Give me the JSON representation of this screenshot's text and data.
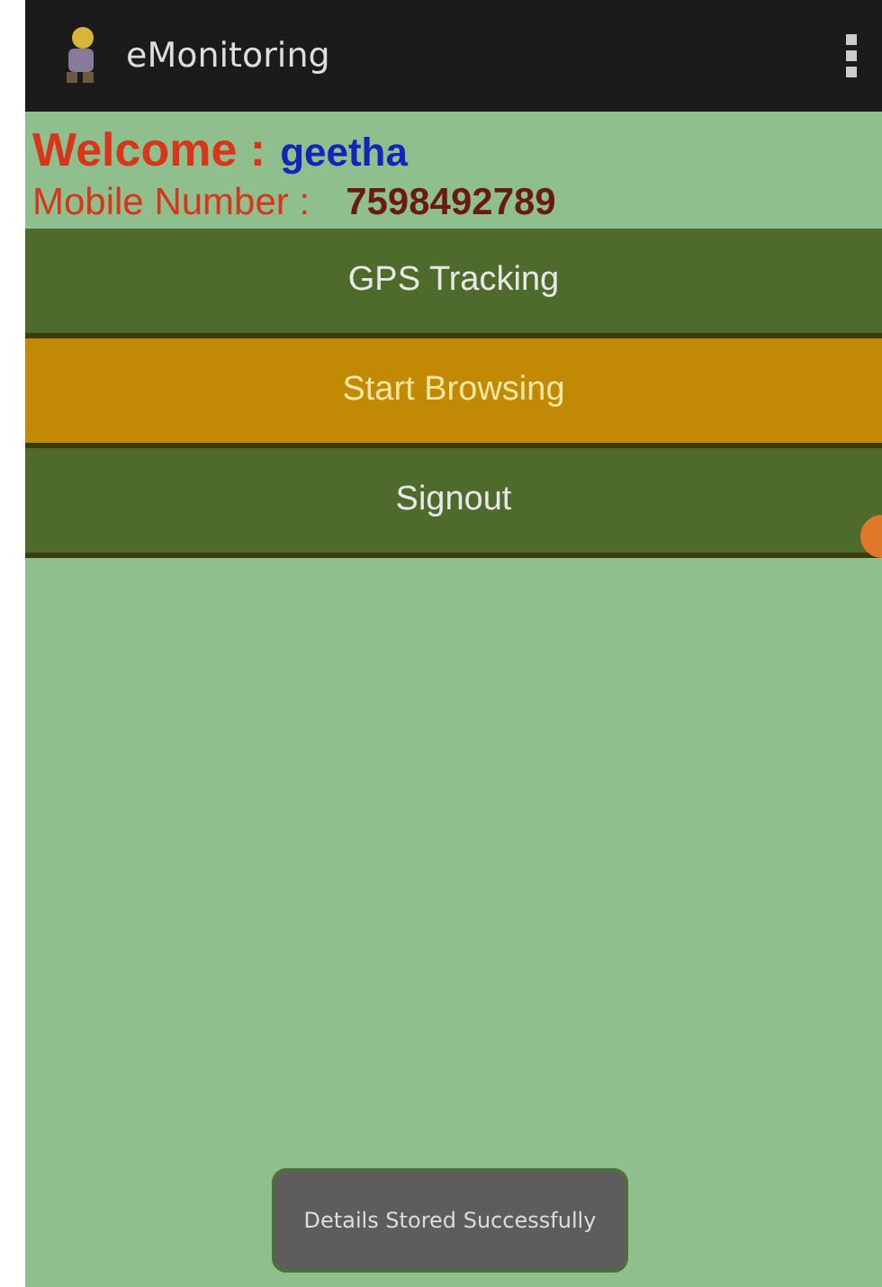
{
  "app_bar": {
    "title": "eMonitoring"
  },
  "welcome": {
    "label": "Welcome :",
    "name": "geetha"
  },
  "mobile": {
    "label": "Mobile Number :",
    "number": "7598492789"
  },
  "buttons": [
    {
      "label": "GPS Tracking",
      "selected": false
    },
    {
      "label": "Start Browsing",
      "selected": true
    },
    {
      "label": "Signout",
      "selected": false
    }
  ],
  "toast": "Details Stored Successfully"
}
